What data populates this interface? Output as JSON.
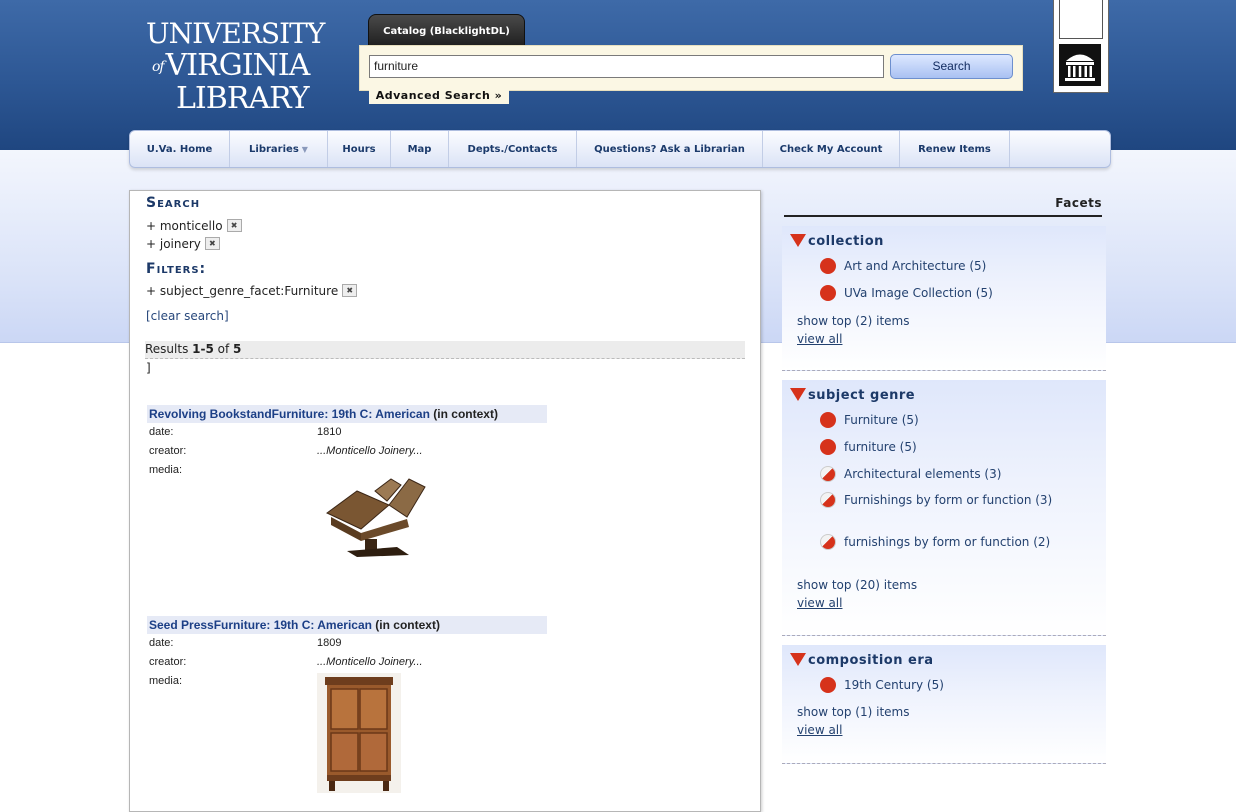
{
  "header": {
    "logo_line1": "UNIVERSITY",
    "logo_of": "of",
    "logo_line2": "VIRGINIA",
    "logo_line3": "LIBRARY",
    "catalog_tab": "Catalog (BlacklightDL)",
    "search_value": "furniture",
    "search_button": "Search",
    "advanced_search": "Advanced Search »"
  },
  "nav": {
    "items": [
      {
        "label": "U.Va. Home"
      },
      {
        "label": "Libraries"
      },
      {
        "label": "Hours"
      },
      {
        "label": "Map"
      },
      {
        "label": "Depts./Contacts"
      },
      {
        "label": "Questions? Ask a Librarian"
      },
      {
        "label": "Check My Account"
      },
      {
        "label": "Renew Items"
      }
    ]
  },
  "search_panel": {
    "search_heading": "Search",
    "queries": [
      "+ monticello",
      "+ joinery"
    ],
    "filters_heading": "Filters:",
    "filters": [
      "+ subject_genre_facet:Furniture"
    ],
    "clear_search": "[clear search]",
    "results_prefix": "Results ",
    "results_range": "1-5",
    "results_of": " of ",
    "results_total": "5",
    "results_bracket": "]"
  },
  "records": [
    {
      "title": "Revolving BookstandFurniture: 19th C: American",
      "context": " (in context)",
      "date_label": "date:",
      "date": "1810",
      "creator_label": "creator:",
      "creator": "...Monticello Joinery...",
      "media_label": "media:"
    },
    {
      "title": "Seed PressFurniture: 19th C: American",
      "context": " (in context)",
      "date_label": "date:",
      "date": "1809",
      "creator_label": "creator:",
      "creator": "...Monticello Joinery...",
      "media_label": "media:"
    }
  ],
  "facets": {
    "heading": "Facets",
    "groups": [
      {
        "title": "collection",
        "items": [
          "Art and Architecture (5)",
          "UVa Image Collection (5)"
        ],
        "show_top": "show top (2) items",
        "view_all": "view all"
      },
      {
        "title": "subject genre",
        "items": [
          "Furniture (5)",
          "furniture (5)",
          "Architectural elements (3)",
          "Furnishings by form or function (3)",
          "furnishings by form or function (2)"
        ],
        "show_top": "show top (20) items",
        "view_all": "view all"
      },
      {
        "title": "composition era",
        "items": [
          "19th Century (5)"
        ],
        "show_top": "show top (1) items",
        "view_all": "view all"
      }
    ]
  },
  "colors": {
    "header_blue": "#2d5794",
    "link_blue": "#1c3f86",
    "facet_red": "#d6321b"
  }
}
